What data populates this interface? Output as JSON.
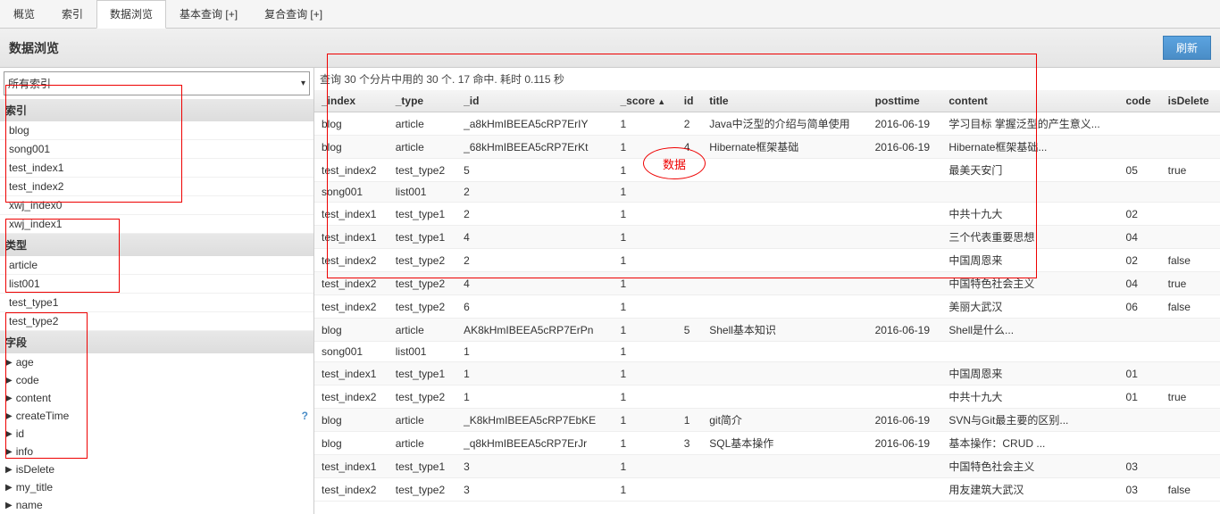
{
  "tabs": [
    {
      "label": "概览"
    },
    {
      "label": "索引"
    },
    {
      "label": "数据浏览",
      "active": true
    },
    {
      "label": "基本查询 [+]"
    },
    {
      "label": "复合查询 [+]"
    }
  ],
  "pageTitle": "数据浏览",
  "refreshLabel": "刷新",
  "dropdownValue": "所有索引",
  "sections": {
    "index": {
      "header": "索引",
      "items": [
        "blog",
        "song001",
        "test_index1",
        "test_index2",
        "xwj_index0",
        "xwj_index1"
      ]
    },
    "type": {
      "header": "类型",
      "items": [
        "article",
        "list001",
        "test_type1",
        "test_type2"
      ]
    },
    "field": {
      "header": "字段",
      "items": [
        "age",
        "code",
        "content",
        "createTime",
        "id",
        "info",
        "isDelete",
        "my_title",
        "name"
      ]
    }
  },
  "queryStatus": "查询 30 个分片中用的 30 个. 17 命中. 耗时 0.115 秒",
  "dataLabel": "数据",
  "columns": [
    "_index",
    "_type",
    "_id",
    "_score",
    "id",
    "title",
    "posttime",
    "content",
    "code",
    "isDelete"
  ],
  "sortColumn": "_score",
  "rows": [
    {
      "_index": "blog",
      "_type": "article",
      "_id": "_a8kHmIBEEA5cRP7ErIY",
      "_score": "1",
      "id": "2",
      "title": "Java中泛型的介绍与简单使用",
      "posttime": "2016-06-19",
      "content": "学习目标 掌握泛型的产生意义...",
      "code": "",
      "isDelete": ""
    },
    {
      "_index": "blog",
      "_type": "article",
      "_id": "_68kHmIBEEA5cRP7ErKt",
      "_score": "1",
      "id": "4",
      "title": "Hibernate框架基础",
      "posttime": "2016-06-19",
      "content": "Hibernate框架基础...",
      "code": "",
      "isDelete": ""
    },
    {
      "_index": "test_index2",
      "_type": "test_type2",
      "_id": "5",
      "_score": "1",
      "id": "",
      "title": "",
      "posttime": "",
      "content": "最美天安门",
      "code": "05",
      "isDelete": "true"
    },
    {
      "_index": "song001",
      "_type": "list001",
      "_id": "2",
      "_score": "1",
      "id": "",
      "title": "",
      "posttime": "",
      "content": "",
      "code": "",
      "isDelete": ""
    },
    {
      "_index": "test_index1",
      "_type": "test_type1",
      "_id": "2",
      "_score": "1",
      "id": "",
      "title": "",
      "posttime": "",
      "content": "中共十九大",
      "code": "02",
      "isDelete": ""
    },
    {
      "_index": "test_index1",
      "_type": "test_type1",
      "_id": "4",
      "_score": "1",
      "id": "",
      "title": "",
      "posttime": "",
      "content": "三个代表重要思想",
      "code": "04",
      "isDelete": ""
    },
    {
      "_index": "test_index2",
      "_type": "test_type2",
      "_id": "2",
      "_score": "1",
      "id": "",
      "title": "",
      "posttime": "",
      "content": "中国周恩来",
      "code": "02",
      "isDelete": "false"
    },
    {
      "_index": "test_index2",
      "_type": "test_type2",
      "_id": "4",
      "_score": "1",
      "id": "",
      "title": "",
      "posttime": "",
      "content": "中国特色社会主义",
      "code": "04",
      "isDelete": "true"
    },
    {
      "_index": "test_index2",
      "_type": "test_type2",
      "_id": "6",
      "_score": "1",
      "id": "",
      "title": "",
      "posttime": "",
      "content": "美丽大武汉",
      "code": "06",
      "isDelete": "false"
    },
    {
      "_index": "blog",
      "_type": "article",
      "_id": "AK8kHmIBEEA5cRP7ErPn",
      "_score": "1",
      "id": "5",
      "title": "Shell基本知识",
      "posttime": "2016-06-19",
      "content": "Shell是什么...",
      "code": "",
      "isDelete": ""
    },
    {
      "_index": "song001",
      "_type": "list001",
      "_id": "1",
      "_score": "1",
      "id": "",
      "title": "",
      "posttime": "",
      "content": "",
      "code": "",
      "isDelete": ""
    },
    {
      "_index": "test_index1",
      "_type": "test_type1",
      "_id": "1",
      "_score": "1",
      "id": "",
      "title": "",
      "posttime": "",
      "content": "中国周恩来",
      "code": "01",
      "isDelete": ""
    },
    {
      "_index": "test_index2",
      "_type": "test_type2",
      "_id": "1",
      "_score": "1",
      "id": "",
      "title": "",
      "posttime": "",
      "content": "中共十九大",
      "code": "01",
      "isDelete": "true"
    },
    {
      "_index": "blog",
      "_type": "article",
      "_id": "_K8kHmIBEEA5cRP7EbKE",
      "_score": "1",
      "id": "1",
      "title": "git简介",
      "posttime": "2016-06-19",
      "content": "SVN与Git最主要的区别...",
      "code": "",
      "isDelete": ""
    },
    {
      "_index": "blog",
      "_type": "article",
      "_id": "_q8kHmIBEEA5cRP7ErJr",
      "_score": "1",
      "id": "3",
      "title": "SQL基本操作",
      "posttime": "2016-06-19",
      "content": "基本操作：CRUD ...",
      "code": "",
      "isDelete": ""
    },
    {
      "_index": "test_index1",
      "_type": "test_type1",
      "_id": "3",
      "_score": "1",
      "id": "",
      "title": "",
      "posttime": "",
      "content": "中国特色社会主义",
      "code": "03",
      "isDelete": ""
    },
    {
      "_index": "test_index2",
      "_type": "test_type2",
      "_id": "3",
      "_score": "1",
      "id": "",
      "title": "",
      "posttime": "",
      "content": "用友建筑大武汉",
      "code": "03",
      "isDelete": "false"
    }
  ]
}
